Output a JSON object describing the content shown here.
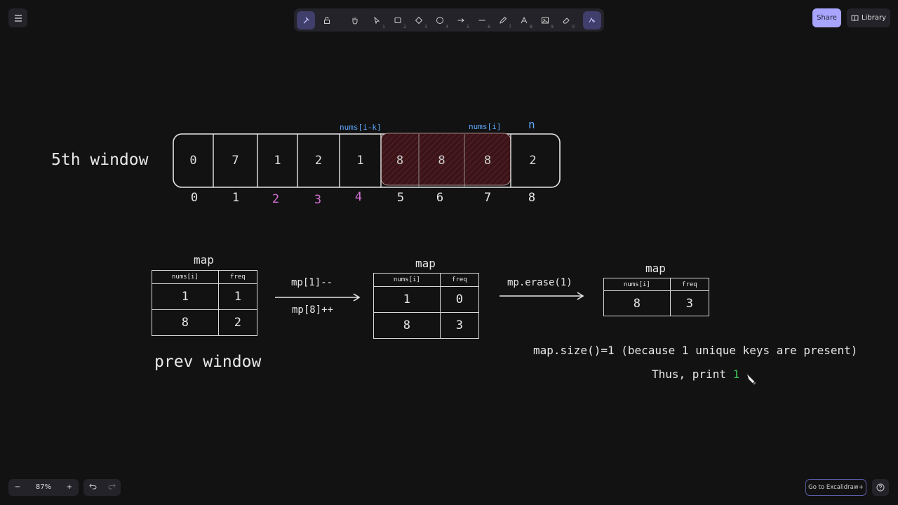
{
  "toolbar": {
    "tools": [
      "lock",
      "hand",
      "selection",
      "rectangle",
      "diamond",
      "ellipse",
      "arrow",
      "line",
      "draw",
      "text",
      "image",
      "eraser"
    ],
    "tool_numbers": [
      "1",
      "2",
      "3",
      "4",
      "5",
      "6",
      "7",
      "8",
      "9",
      "0"
    ],
    "share_label": "Share",
    "library_label": "Library",
    "accent": "#a8a5ff"
  },
  "footer": {
    "zoom_level": "87%",
    "zoom_out": "−",
    "zoom_in": "+",
    "excalidraw_plus": "Go to Excalidraw+"
  },
  "canvas": {
    "window_title": "5th window",
    "label_i_k": "nums[i-k]",
    "label_i": "nums[i]",
    "label_n": "n",
    "array_values": [
      "0",
      "7",
      "1",
      "2",
      "1",
      "8",
      "8",
      "8",
      "2"
    ],
    "indices": [
      "0",
      "1",
      "2",
      "3",
      "4",
      "5",
      "6",
      "7",
      "8"
    ],
    "map_title_1": "map",
    "map_title_2": "map",
    "map_title_3": "map",
    "col_key": "nums[i]",
    "col_freq": "freq",
    "map1": [
      [
        "1",
        "1"
      ],
      [
        "8",
        "2"
      ]
    ],
    "map2": [
      [
        "1",
        "0"
      ],
      [
        "8",
        "3"
      ]
    ],
    "map3": [
      [
        "8",
        "3"
      ]
    ],
    "op_dec": "mp[1]--",
    "op_inc": "mp[8]++",
    "op_erase": "mp.erase(1)",
    "prev_window": "prev window",
    "size_note": "map.size()=1 (because 1 unique keys are present)",
    "print_prefix": "Thus, print",
    "print_value": "1",
    "colors": {
      "index_highlight": "#d070d0",
      "label_blue": "#5fa8ff",
      "window_fill": "#3a1418",
      "result_green": "#40c057"
    }
  }
}
